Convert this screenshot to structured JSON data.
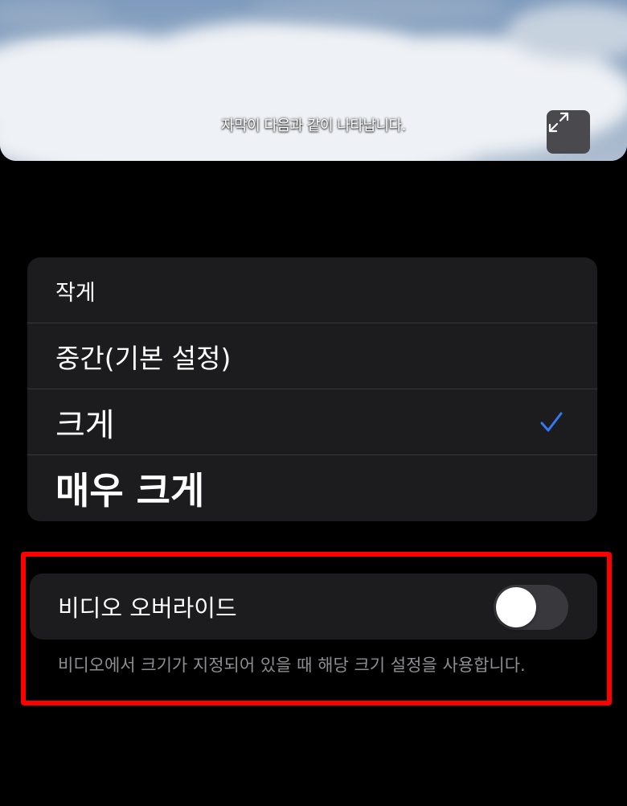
{
  "preview": {
    "subtitle": "자막이 다음과 같이 나타납니다.",
    "expand_icon": "expand-arrows-icon"
  },
  "size_options": {
    "items": [
      {
        "label": "작게",
        "selected": false
      },
      {
        "label": "중간(기본 설정)",
        "selected": false
      },
      {
        "label": "크게",
        "selected": true
      },
      {
        "label": "매우 크게",
        "selected": false
      }
    ],
    "check_icon": "checkmark-icon"
  },
  "override": {
    "label": "비디오 오버라이드",
    "enabled": false,
    "description": "비디오에서 크기가 지정되어 있을 때 해당 크기 설정을 사용합니다."
  },
  "colors": {
    "background": "#000000",
    "card": "#1c1c1e",
    "accent": "#3478f6",
    "highlight": "#ff0000",
    "toggle_off": "#39393d"
  }
}
